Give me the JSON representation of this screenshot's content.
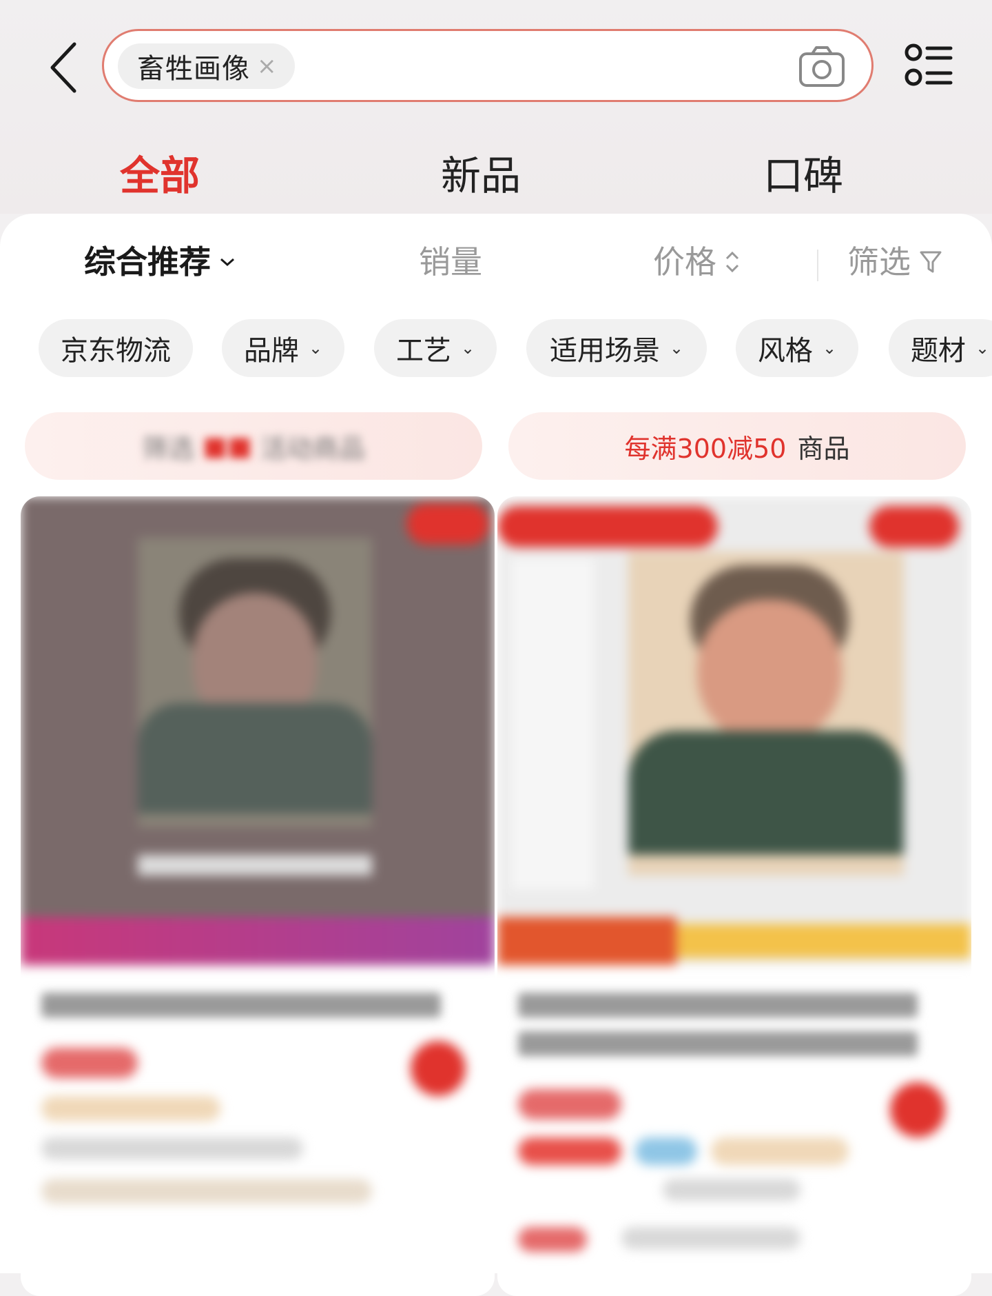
{
  "search": {
    "query_chip": "畜牲画像",
    "clear": "×"
  },
  "tabs": [
    {
      "label": "全部"
    },
    {
      "label": "新品"
    },
    {
      "label": "口碑"
    }
  ],
  "sort": {
    "recommend": "综合推荐",
    "sales": "销量",
    "price": "价格",
    "filter": "筛选"
  },
  "filter_chips": [
    {
      "label": "京东物流"
    },
    {
      "label": "品牌"
    },
    {
      "label": "工艺"
    },
    {
      "label": "适用场景"
    },
    {
      "label": "风格"
    },
    {
      "label": "题材"
    }
  ],
  "promos": {
    "left": {
      "text_a": "筛选",
      "text_b": "活动商品"
    },
    "right": {
      "text_a": "每满300减50",
      "text_b": "商品"
    }
  },
  "colors": {
    "accent": "#e0332d",
    "search_border": "#e07c70"
  }
}
